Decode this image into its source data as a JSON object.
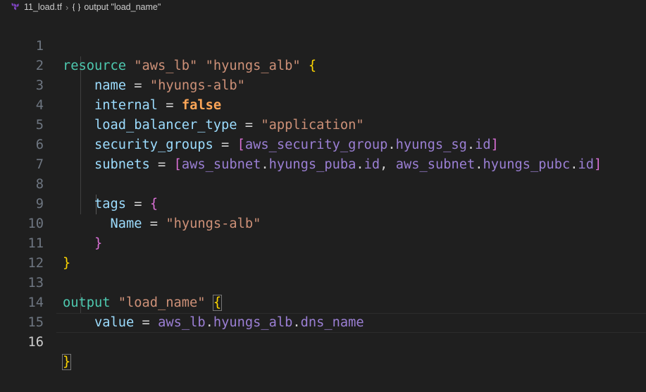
{
  "breadcrumb": {
    "file": "11_load.tf",
    "symbol": "output \"load_name\""
  },
  "line_numbers": [
    "1",
    "2",
    "3",
    "4",
    "5",
    "6",
    "7",
    "8",
    "9",
    "10",
    "11",
    "12",
    "13",
    "14",
    "15",
    "16"
  ],
  "code": {
    "l1": {
      "kw": "resource",
      "s1": "\"aws_lb\"",
      "s2": "\"hyungs_alb\"",
      "brace": "{"
    },
    "l2": {
      "attr": "name",
      "eq": "=",
      "val": "\"hyungs-alb\""
    },
    "l3": {
      "attr": "internal",
      "eq": "=",
      "val": "false"
    },
    "l4": {
      "attr": "load_balancer_type",
      "eq": "=",
      "val": "\"application\""
    },
    "l5": {
      "attr": "security_groups",
      "eq": "=",
      "open": "[",
      "r1": "aws_security_group",
      "r2": "hyungs_sg",
      "r3": "id",
      "close": "]"
    },
    "l6": {
      "attr": "subnets",
      "eq": "=",
      "open": "[",
      "a1": "aws_subnet",
      "a2": "hyungs_puba",
      "a3": "id",
      "comma": ",",
      "b1": "aws_subnet",
      "b2": "hyungs_pubc",
      "b3": "id",
      "close": "]"
    },
    "l8": {
      "attr": "tags",
      "eq": "=",
      "brace": "{"
    },
    "l9": {
      "attr": "Name",
      "eq": "=",
      "val": "\"hyungs-alb\""
    },
    "l10": {
      "brace": "}"
    },
    "l11": {
      "brace": "}"
    },
    "l13": {
      "kw": "output",
      "s1": "\"load_name\"",
      "brace": "{"
    },
    "l14": {
      "attr": "value",
      "eq": "=",
      "r1": "aws_lb",
      "r2": "hyungs_alb",
      "r3": "dns_name"
    },
    "l16": {
      "brace": "}"
    }
  },
  "colors": {
    "background": "#1f1f1f",
    "keyword": "#4ec9b0",
    "string": "#ce9178",
    "attribute": "#9cdcfe",
    "reference": "#9b7fd4",
    "boolean": "#ffa657",
    "bracket_level1": "#ffd700",
    "bracket_level2": "#da70d6"
  },
  "icons": {
    "file": "terraform-icon",
    "symbol": "symbol-brackets-icon"
  },
  "cursor_line": "16"
}
